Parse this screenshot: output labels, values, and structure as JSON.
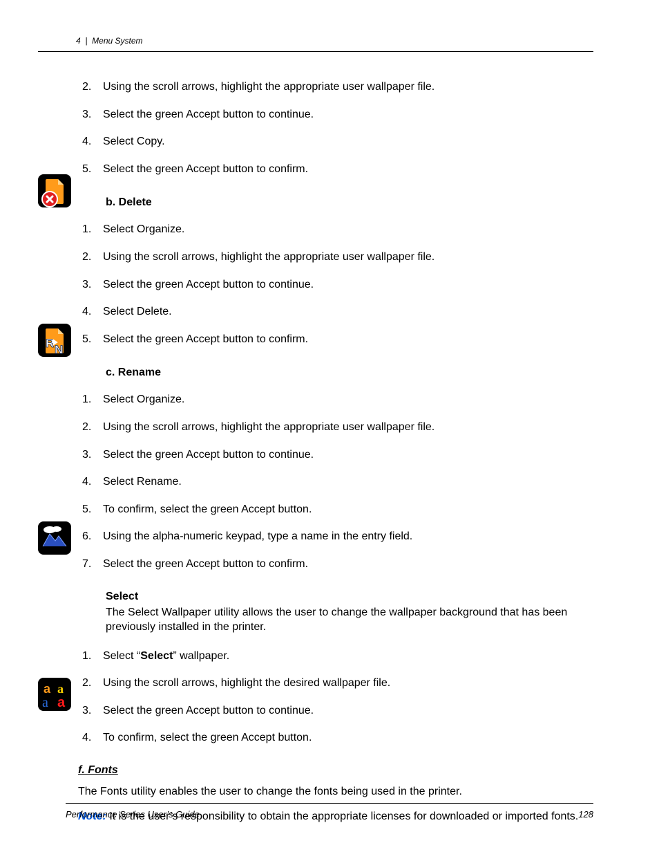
{
  "header": {
    "chapter_num": "4",
    "divider": "|",
    "chapter_title": "Menu System"
  },
  "steps_a": [
    {
      "num": "2.",
      "text": "Using the scroll arrows, highlight the appropriate user wallpaper file."
    },
    {
      "num": "3.",
      "text": "Select the green Accept button to continue."
    },
    {
      "num": "4.",
      "text": "Select Copy."
    },
    {
      "num": "5.",
      "text": "Select the green Accept button to confirm."
    }
  ],
  "section_b": {
    "title": "b. Delete"
  },
  "steps_b": [
    {
      "num": "1.",
      "text": "Select Organize."
    },
    {
      "num": "2.",
      "text": "Using the scroll arrows, highlight the appropriate user wallpaper file."
    },
    {
      "num": "3.",
      "text": "Select the green Accept button to continue."
    },
    {
      "num": "4.",
      "text": "Select Delete."
    },
    {
      "num": "5.",
      "text": "Select the green Accept button to confirm."
    }
  ],
  "section_c": {
    "title": "c. Rename"
  },
  "steps_c": [
    {
      "num": "1.",
      "text": "Select Organize."
    },
    {
      "num": "2.",
      "text": "Using the scroll arrows, highlight the appropriate user wallpaper file."
    },
    {
      "num": "3.",
      "text": "Select the green Accept button to continue."
    },
    {
      "num": "4.",
      "text": "Select Rename."
    },
    {
      "num": "5.",
      "text": "To confirm, select the green Accept button."
    },
    {
      "num": "6.",
      "text": "Using the alpha-numeric keypad, type a name in the entry field."
    },
    {
      "num": "7.",
      "text": "Select the green Accept button to confirm."
    }
  ],
  "section_select": {
    "title": "Select",
    "description": "The Select Wallpaper utility allows the user to change the wallpaper background that has been previously installed in the printer."
  },
  "steps_select": [
    {
      "num": "1.",
      "prefix": "Select “",
      "bold": "Select",
      "suffix": "” wallpaper."
    },
    {
      "num": "2.",
      "text": "Using the scroll arrows, highlight the desired wallpaper file."
    },
    {
      "num": "3.",
      "text": "Select the green Accept button to continue."
    },
    {
      "num": "4.",
      "text": "To confirm, select the green Accept button."
    }
  ],
  "section_f": {
    "title": "f.  Fonts",
    "description": "The Fonts utility enables the user to change the fonts being used in the printer.",
    "note_label": "Note:",
    "note_text": "It is the user’s responsibility to obtain the appropriate licenses for downloaded or imported fonts."
  },
  "footer": {
    "title": "Performance Series User’s Guide",
    "page": "128"
  }
}
